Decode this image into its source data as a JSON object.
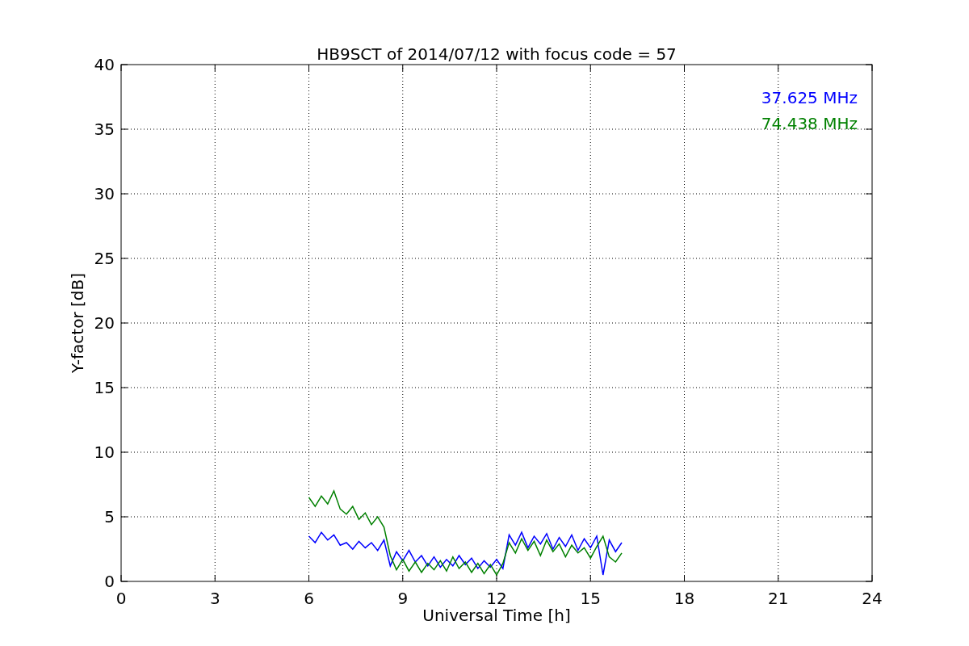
{
  "chart_data": {
    "type": "line",
    "title": "HB9SCT of 2014/07/12 with focus code = 57",
    "xlabel": "Universal Time [h]",
    "ylabel": "Y-factor [dB]",
    "x": [
      6.0,
      6.2,
      6.4,
      6.6,
      6.8,
      7.0,
      7.2,
      7.4,
      7.6,
      7.8,
      8.0,
      8.2,
      8.4,
      8.6,
      8.8,
      9.0,
      9.2,
      9.4,
      9.6,
      9.8,
      10.0,
      10.2,
      10.4,
      10.6,
      10.8,
      11.0,
      11.2,
      11.4,
      11.6,
      11.8,
      12.0,
      12.2,
      12.4,
      12.6,
      12.8,
      13.0,
      13.2,
      13.4,
      13.6,
      13.8,
      14.0,
      14.2,
      14.4,
      14.6,
      14.8,
      15.0,
      15.2,
      15.4,
      15.6,
      15.8,
      16.0
    ],
    "series": [
      {
        "name": "37.625 MHz",
        "color": "#0000ff",
        "values": [
          3.5,
          3.0,
          3.8,
          3.2,
          3.6,
          2.8,
          3.0,
          2.5,
          3.1,
          2.6,
          3.0,
          2.4,
          3.2,
          1.2,
          2.3,
          1.6,
          2.4,
          1.5,
          2.0,
          1.2,
          1.9,
          1.1,
          1.7,
          1.2,
          2.0,
          1.3,
          1.8,
          1.0,
          1.6,
          1.1,
          1.7,
          1.0,
          3.6,
          2.8,
          3.8,
          2.6,
          3.5,
          2.9,
          3.7,
          2.5,
          3.4,
          2.7,
          3.6,
          2.4,
          3.3,
          2.6,
          3.5,
          0.5,
          3.2,
          2.3,
          3.0
        ]
      },
      {
        "name": "74.438 MHz",
        "color": "#008000",
        "values": [
          6.5,
          5.8,
          6.6,
          6.0,
          7.0,
          5.6,
          5.2,
          5.8,
          4.8,
          5.3,
          4.4,
          5.0,
          4.2,
          2.0,
          0.9,
          1.7,
          0.8,
          1.5,
          0.7,
          1.4,
          0.9,
          1.6,
          0.8,
          1.9,
          1.0,
          1.5,
          0.7,
          1.4,
          0.6,
          1.3,
          0.5,
          1.4,
          3.0,
          2.2,
          3.3,
          2.4,
          3.1,
          2.0,
          3.2,
          2.3,
          2.9,
          1.9,
          2.8,
          2.2,
          2.6,
          1.8,
          2.7,
          3.5,
          1.9,
          1.5,
          2.2
        ]
      }
    ],
    "xlim": [
      0,
      24
    ],
    "ylim": [
      0,
      40
    ],
    "xticks": [
      0,
      3,
      6,
      9,
      12,
      15,
      18,
      21,
      24
    ],
    "yticks": [
      0,
      5,
      10,
      15,
      20,
      25,
      30,
      35,
      40
    ],
    "grid": true
  }
}
